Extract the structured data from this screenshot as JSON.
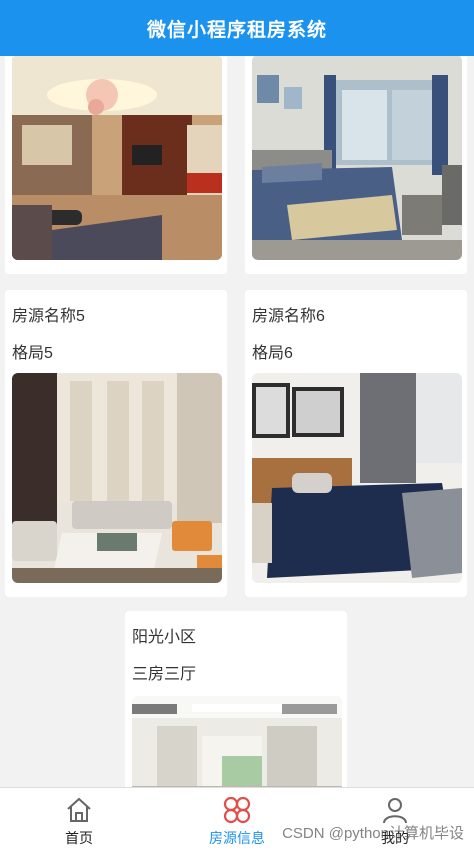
{
  "header": {
    "title": "微信小程序租房系统"
  },
  "listings": [
    {
      "name": "",
      "layout": ""
    },
    {
      "name": "",
      "layout": ""
    },
    {
      "name": "房源名称5",
      "layout": "格局5"
    },
    {
      "name": "房源名称6",
      "layout": "格局6"
    },
    {
      "name": "阳光小区",
      "layout": "三房三厅"
    }
  ],
  "tabbar": {
    "items": [
      {
        "label": "首页",
        "icon": "home-icon"
      },
      {
        "label": "房源信息",
        "icon": "listing-grid-icon"
      },
      {
        "label": "我的",
        "icon": "user-icon"
      }
    ],
    "active_index": 1,
    "accent_color": "#1c92ef"
  },
  "watermark": "CSDN @python计算机毕设"
}
